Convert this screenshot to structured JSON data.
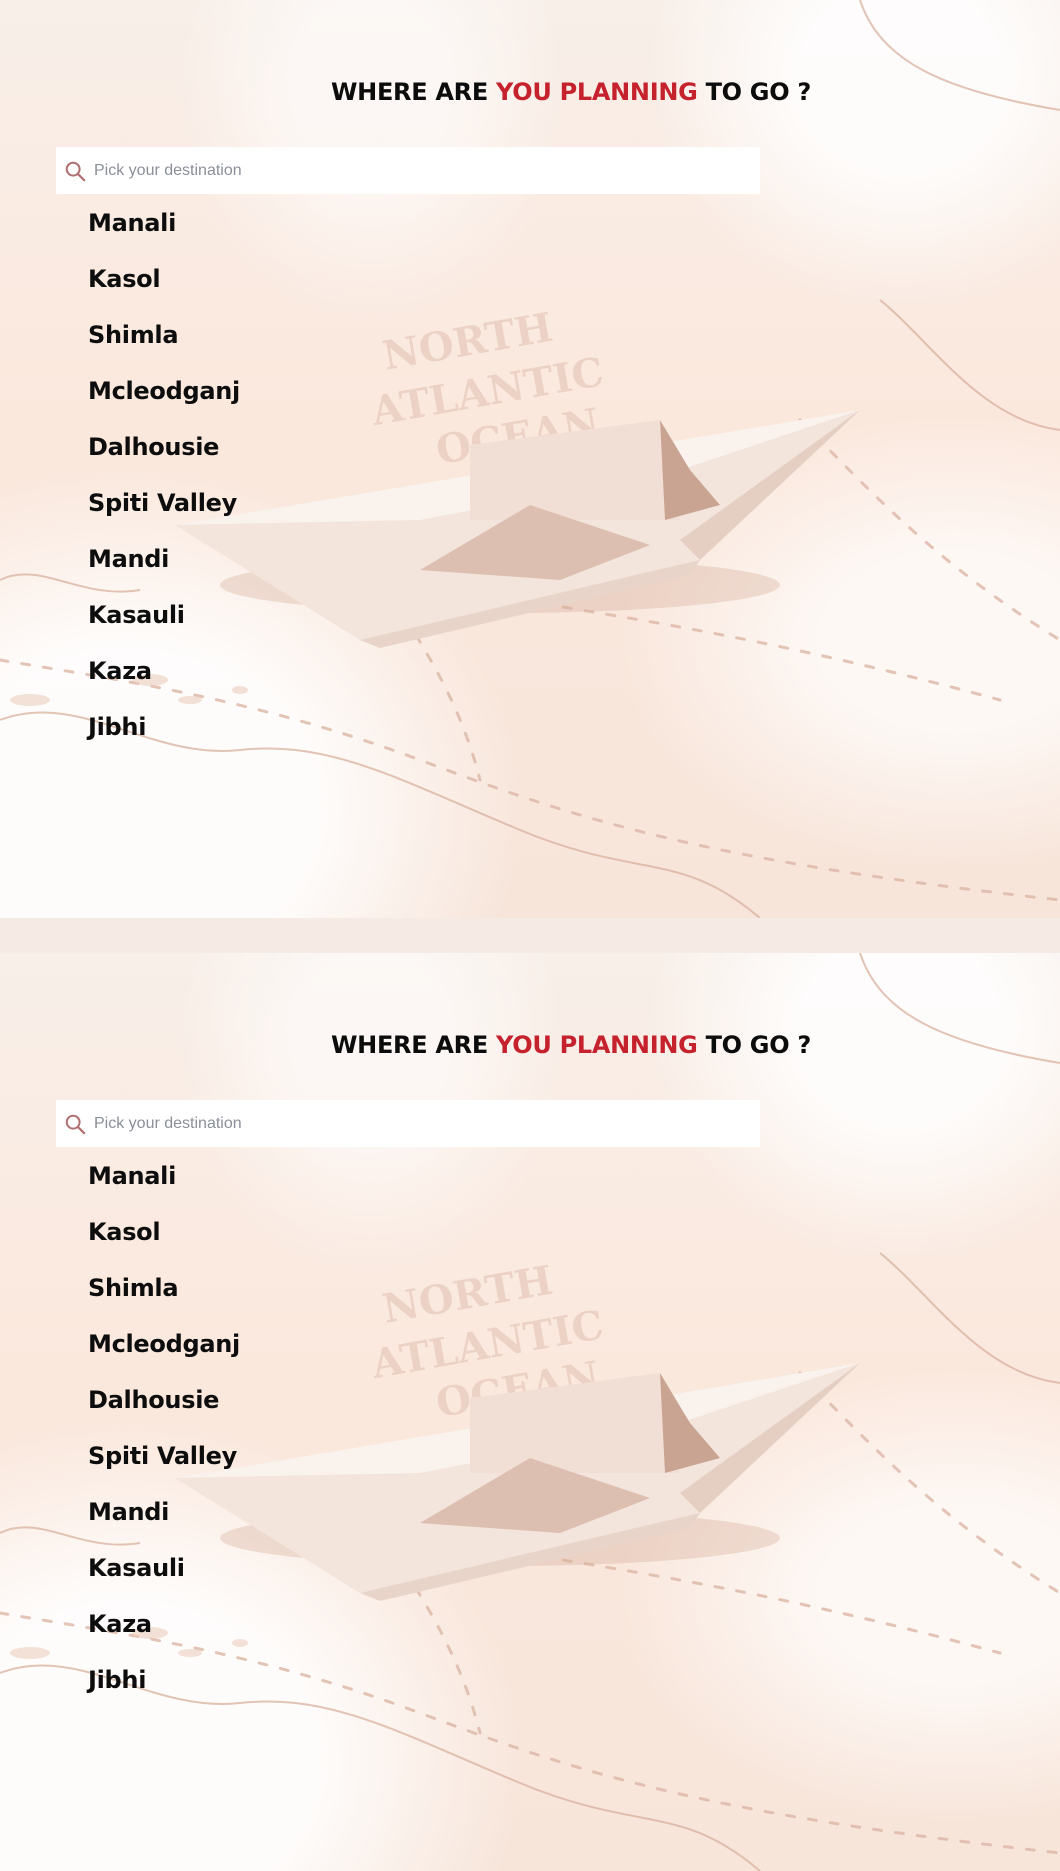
{
  "panels": [
    {
      "heading": {
        "part1": "WHERE ARE ",
        "accent": "YOU PLANNING",
        "part2": " TO GO ?"
      },
      "search": {
        "icon": "search-icon",
        "placeholder": "Pick your destination",
        "value": ""
      },
      "destinations": [
        "Manali",
        "Kasol",
        "Shimla",
        "Mcleodganj",
        "Dalhousie",
        "Spiti Valley",
        "Mandi",
        "Kasauli",
        "Kaza",
        "Jibhi"
      ]
    },
    {
      "heading": {
        "part1": "WHERE ARE ",
        "accent": "YOU PLANNING",
        "part2": " TO GO ?"
      },
      "search": {
        "icon": "search-icon",
        "placeholder": "Pick your destination",
        "value": ""
      },
      "destinations": [
        "Manali",
        "Kasol",
        "Shimla",
        "Mcleodganj",
        "Dalhousie",
        "Spiti Valley",
        "Mandi",
        "Kasauli",
        "Kaza",
        "Jibhi"
      ]
    }
  ],
  "background_map_text": [
    "NORTH",
    "ATLANTIC",
    "OCEAN"
  ],
  "colors": {
    "accent": "#c5222d",
    "heading_text": "#0c0c0c",
    "background": "#fbe8dd",
    "search_background": "#ffffff",
    "placeholder": "#8a8f98",
    "search_icon": "#b07070"
  }
}
